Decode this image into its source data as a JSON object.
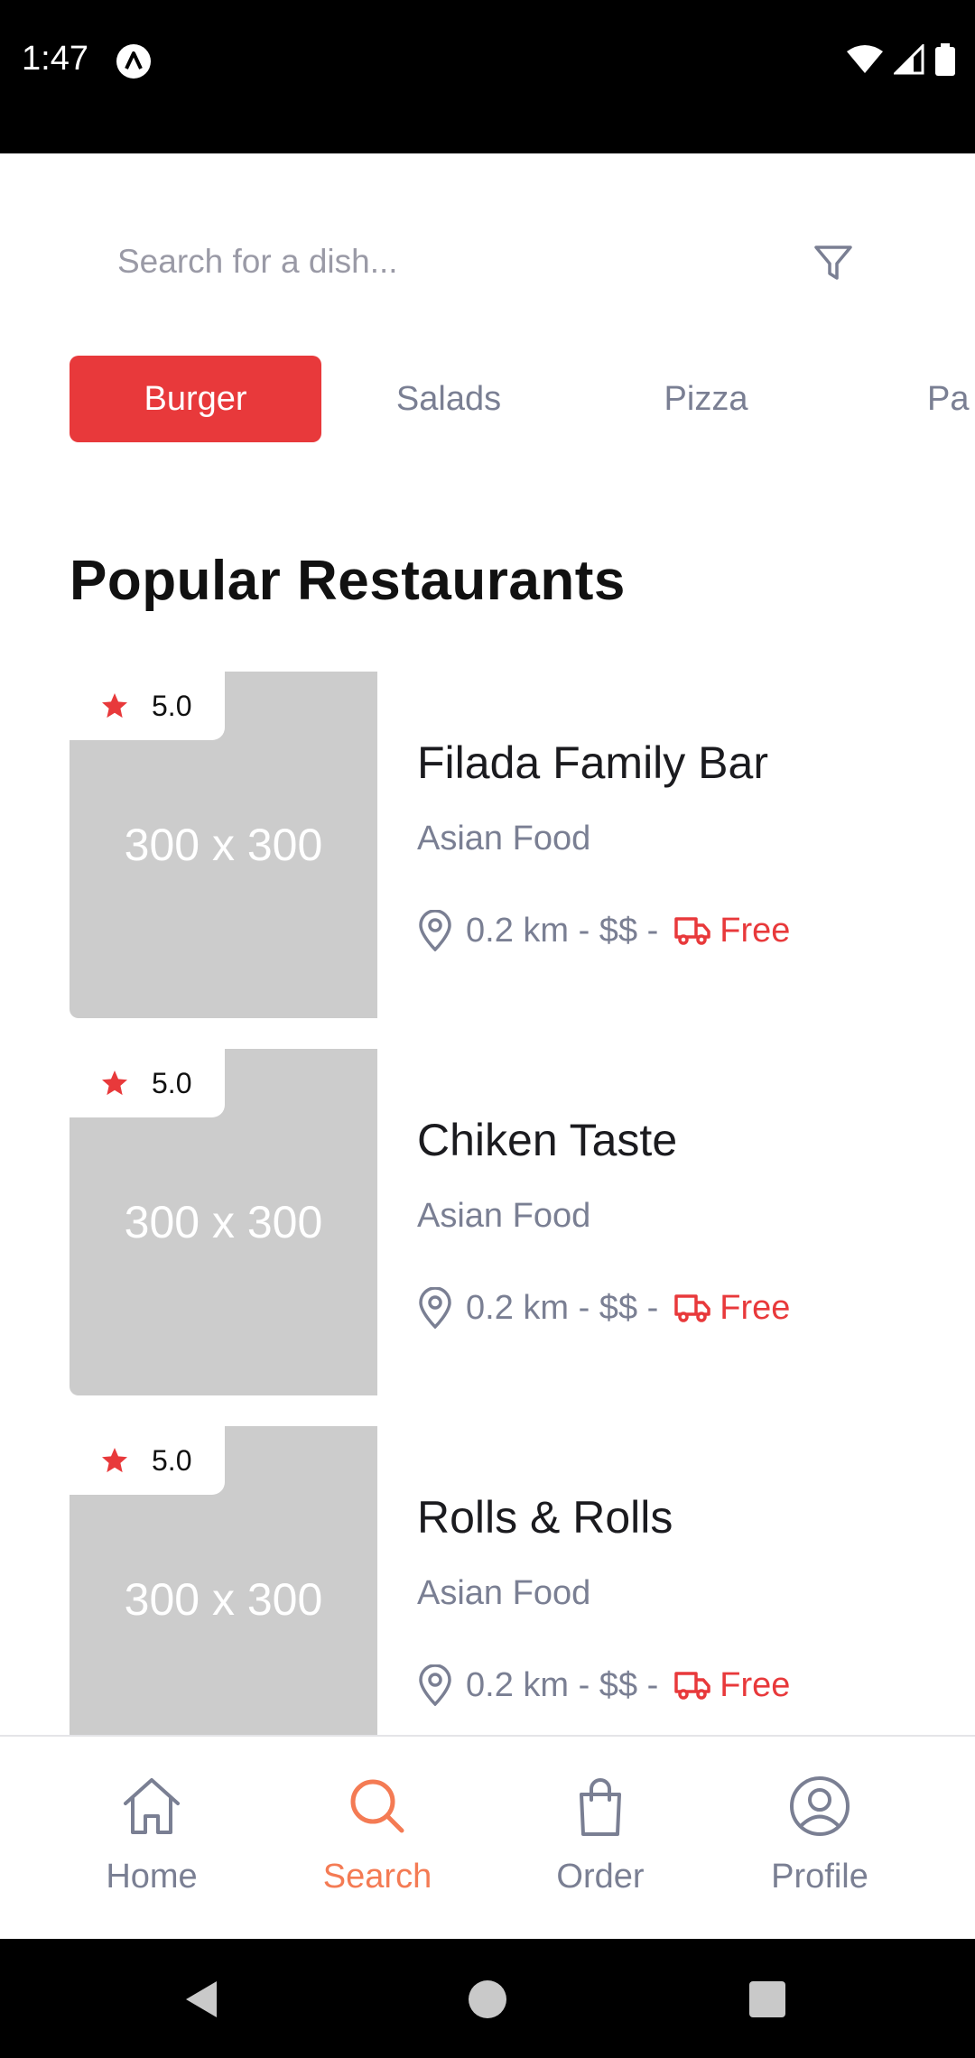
{
  "status_bar": {
    "time": "1:47"
  },
  "search": {
    "placeholder": "Search for a dish..."
  },
  "categories": [
    {
      "label": "Burger",
      "active": true
    },
    {
      "label": "Salads",
      "active": false
    },
    {
      "label": "Pizza",
      "active": false
    },
    {
      "label": "Pa",
      "active": false
    }
  ],
  "section_title": "Popular Restaurants",
  "restaurants": [
    {
      "rating": "5.0",
      "image_label": "300 x 300",
      "name": "Filada Family Bar",
      "cuisine": "Asian Food",
      "meta": "0.2 km - $$ -",
      "delivery": "Free"
    },
    {
      "rating": "5.0",
      "image_label": "300 x 300",
      "name": "Chiken Taste",
      "cuisine": "Asian Food",
      "meta": "0.2 km - $$ -",
      "delivery": "Free"
    },
    {
      "rating": "5.0",
      "image_label": "300 x 300",
      "name": "Rolls & Rolls",
      "cuisine": "Asian Food",
      "meta": "0.2 km - $$ -",
      "delivery": "Free"
    }
  ],
  "bottom_nav": [
    {
      "label": "Home",
      "icon": "home-icon",
      "active": false
    },
    {
      "label": "Search",
      "icon": "search-icon",
      "active": true
    },
    {
      "label": "Order",
      "icon": "shopping-bag-icon",
      "active": false
    },
    {
      "label": "Profile",
      "icon": "profile-icon",
      "active": false
    }
  ],
  "colors": {
    "accent": "#e8393b",
    "nav_active": "#f47b54",
    "muted_text": "#7a7f93",
    "placeholder_bg": "#cccccc"
  }
}
